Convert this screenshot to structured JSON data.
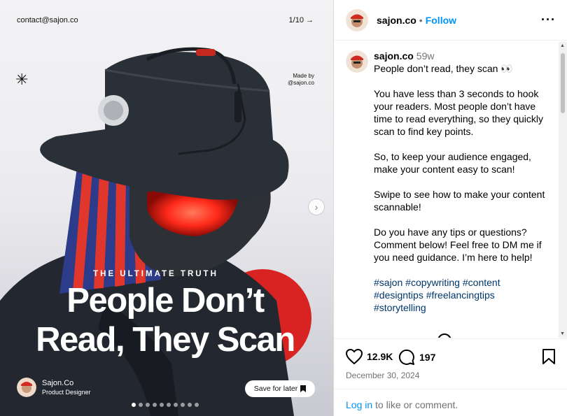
{
  "post_image": {
    "contact": "contact@sajon.co",
    "page_counter": "1/10 →",
    "made_by_line1": "Made by",
    "made_by_line2": "@sajon.co",
    "kicker": "THE ULTIMATE TRUTH",
    "headline_line1": "People Don’t",
    "headline_line2": "Read, They Scan",
    "creator_name": "Sajon.Co",
    "creator_role": "Product Designer",
    "save_for_later": "Save for later",
    "slide_count": 10,
    "active_slide": 1,
    "colors": {
      "accent_red": "#d92323",
      "hat_dark": "#2a3038"
    }
  },
  "header": {
    "username": "sajon.co",
    "separator": "•",
    "follow_label": "Follow",
    "more_label": "···"
  },
  "caption": {
    "username": "sajon.co",
    "time_ago": "59w",
    "line1": "People don’t read, they scan 👀",
    "para1": "You have less than 3 seconds to hook your readers. Most people don’t have time to read everything, so they quickly scan to find key points.",
    "para2": "So, to keep your audience engaged, make your content easy to scan!",
    "para3": "Swipe to see how to make your content scannable!",
    "para4": "Do you have any tips or questions? Comment below! Feel free to DM me if you need guidance. I’m here to help!",
    "hashtags": [
      "#sajon",
      "#copywriting",
      "#content",
      "#designtips",
      "#freelancingtips",
      "#storytelling"
    ]
  },
  "actions": {
    "likes": "12.9K",
    "comments": "197",
    "date": "December 30, 2024"
  },
  "login": {
    "link_label": "Log in",
    "rest": " to like or comment."
  }
}
